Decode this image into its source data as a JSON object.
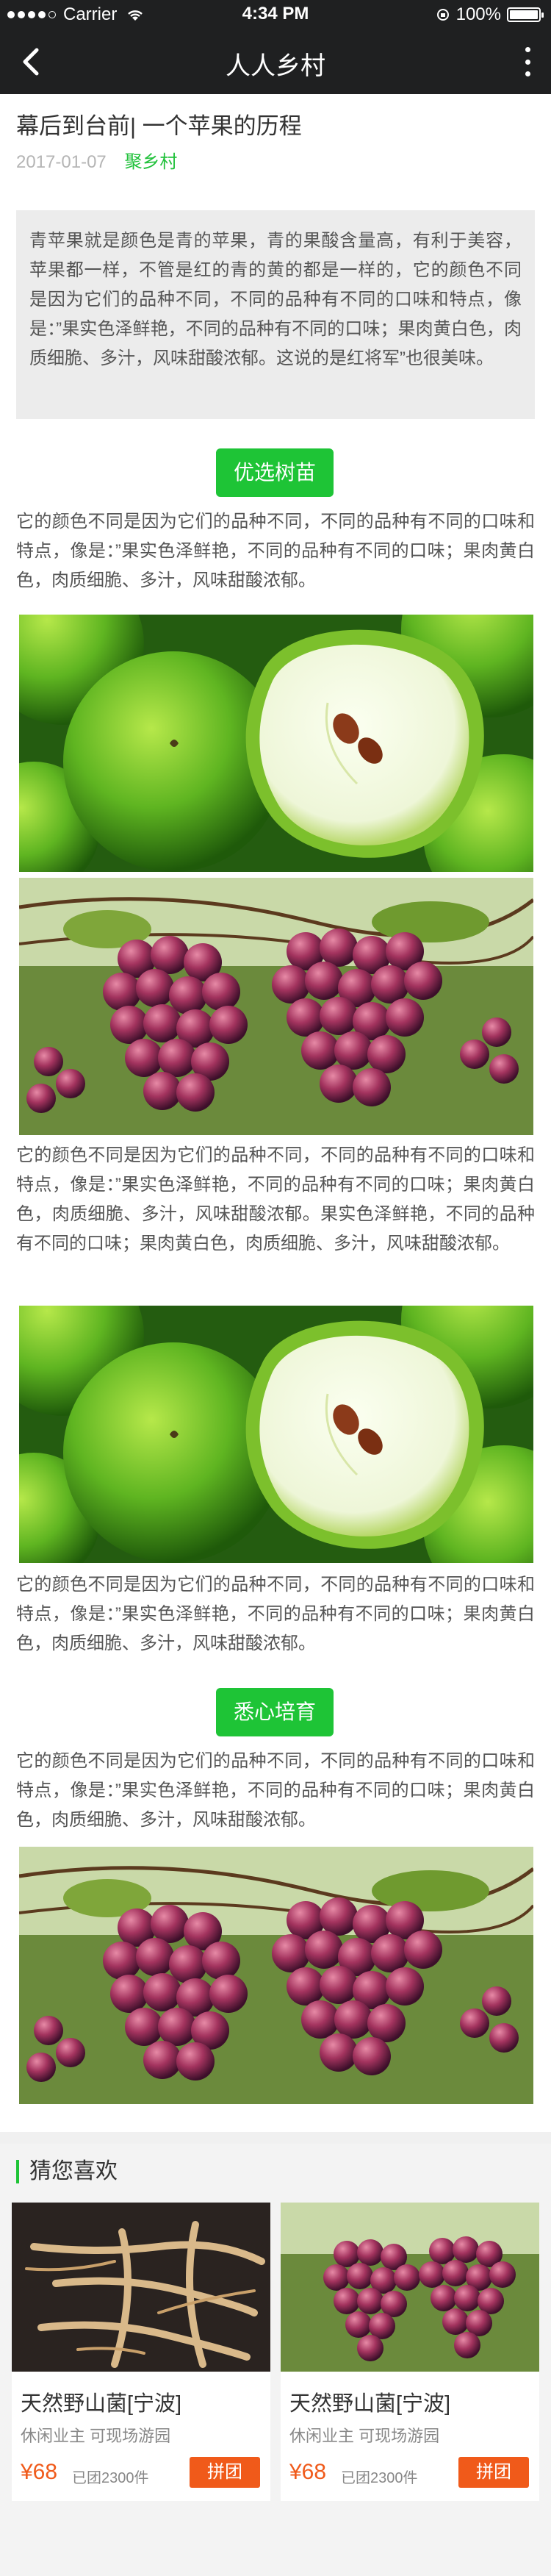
{
  "status_bar": {
    "carrier": "Carrier",
    "time": "4:34 PM",
    "battery": "100%"
  },
  "nav": {
    "title": "人人乡村",
    "back_icon": "chevron-left-icon",
    "more_icon": "more-vertical-icon"
  },
  "article": {
    "title": "幕后到台前| 一个苹果的历程",
    "date": "2017-01-07",
    "source": "聚乡村",
    "intro": "青苹果就是颜色是青的苹果，青的果酸含量高，有利于美容，苹果都一样，不管是红的青的黄的都是一样的，它的颜色不同是因为它们的品种不同，不同的品种有不同的口味和特点，像是：”果实色泽鲜艳，不同的品种有不同的口味；果肉黄白色，肉质细脆、多汁，风味甜酸浓郁。这说的是红将军”也很美味。",
    "section1_label": "优选树苗",
    "para1": "它的颜色不同是因为它们的品种不同，不同的品种有不同的口味和特点，像是：”果实色泽鲜艳，不同的品种有不同的口味；果肉黄白色，肉质细脆、多汁，风味甜酸浓郁。",
    "para2": "它的颜色不同是因为它们的品种不同，不同的品种有不同的口味和特点，像是：”果实色泽鲜艳，不同的品种有不同的口味；果肉黄白色，肉质细脆、多汁，风味甜酸浓郁。果实色泽鲜艳，不同的品种有不同的口味；果肉黄白色，肉质细脆、多汁，风味甜酸浓郁。",
    "para3": "它的颜色不同是因为它们的品种不同，不同的品种有不同的口味和特点，像是：”果实色泽鲜艳，不同的品种有不同的口味；果肉黄白色，肉质细脆、多汁，风味甜酸浓郁。",
    "section2_label": "悉心培育",
    "para4": "它的颜色不同是因为它们的品种不同，不同的品种有不同的口味和特点，像是：”果实色泽鲜艳，不同的品种有不同的口味；果肉黄白色，肉质细脆、多汁，风味甜酸浓郁。"
  },
  "recommend": {
    "title": "猜您喜欢",
    "items": [
      {
        "name": "天然野山菌[宁波]",
        "desc": "休闲业主  可现场游园",
        "price": "¥68",
        "sold": "已团2300件",
        "button": "拼团"
      },
      {
        "name": "天然野山菌[宁波]",
        "desc": "休闲业主  可现场游园",
        "price": "¥68",
        "sold": "已团2300件",
        "button": "拼团"
      }
    ]
  },
  "colors": {
    "accent": "#1ec436",
    "price": "#f05a1a",
    "header": "#1f2021"
  }
}
